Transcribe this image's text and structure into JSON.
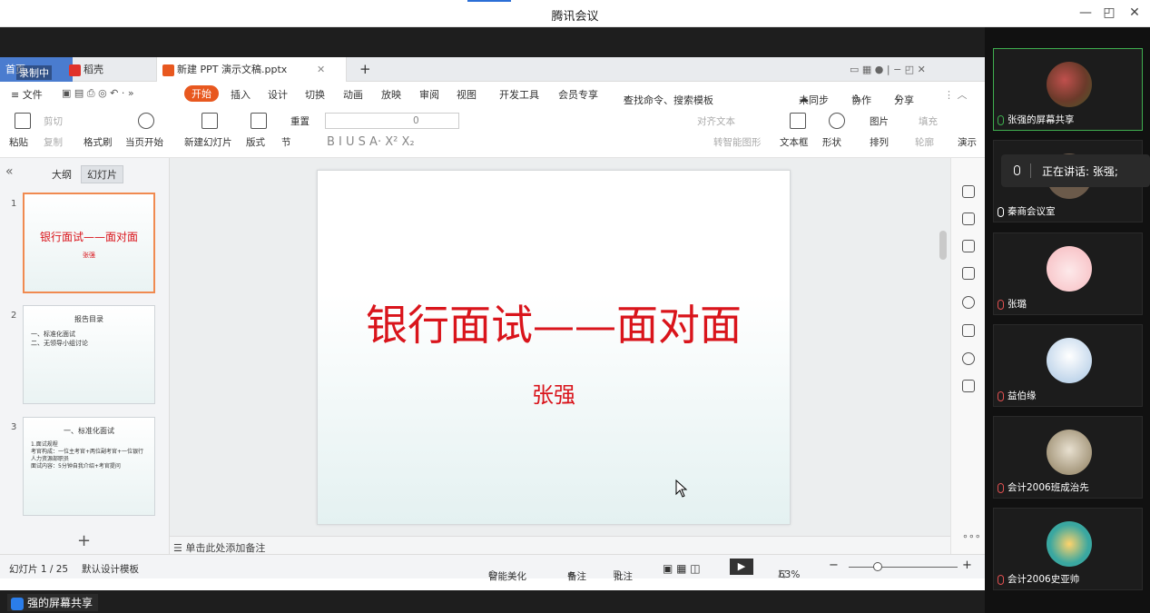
{
  "window": {
    "title": "腾讯会议",
    "minimize": "—",
    "restore": "◰",
    "close": "✕"
  },
  "tabs": {
    "home": "首页",
    "recording": "录制中",
    "daoke": "稻壳",
    "doc": "新建 PPT 演示文稿.pptx",
    "new": "+"
  },
  "menu": [
    "≡ 文件",
    "开始",
    "插入",
    "设计",
    "切换",
    "动画",
    "放映",
    "审阅",
    "视图",
    "开发工具",
    "会员专享"
  ],
  "menu_right": {
    "search": "查找命令、搜索模板",
    "sync": "未同步",
    "collab": "协作",
    "share": "分享"
  },
  "ribbon": {
    "paste": "粘贴",
    "cut": "剪切",
    "copy": "复制",
    "format_painter": "格式刷",
    "from_start": "当页开始",
    "new_slide": "新建幻灯片",
    "layout": "版式",
    "section": "节",
    "reset": "重置",
    "font_size": "0",
    "align_text": "对齐文本",
    "smartart": "转智能图形",
    "textbox": "文本框",
    "shape": "形状",
    "picture": "图片",
    "arrange": "排列",
    "fill": "填充",
    "outline": "轮廓",
    "play": "演示"
  },
  "left_panel": {
    "outline": "大纲",
    "slides": "幻灯片",
    "collapse": "«",
    "add": "+"
  },
  "thumbnails": [
    {
      "num": "1",
      "title": "银行面试——面对面",
      "sub": "张强"
    },
    {
      "num": "2",
      "title": "报告目录",
      "items": [
        "一、标准化面试",
        "二、无领导小组讨论"
      ]
    },
    {
      "num": "3",
      "title": "一、标准化面试",
      "items": [
        "1.面试规程",
        "考官构成：一位主考官+两位副考官+一位银行人力资源部职员",
        "面试内容：5分钟自我介绍+考官提问"
      ]
    }
  ],
  "slide": {
    "title": "银行面试——面对面",
    "subtitle": "张强"
  },
  "notes": "单击此处添加备注",
  "status": {
    "slide_counter": "幻灯片 1 / 25",
    "template": "默认设计模板",
    "beautify": "智能美化",
    "notes": "备注",
    "comment": "批注",
    "zoom": "63%"
  },
  "share_label": "强的屏幕共享",
  "speaking": "正在讲话: 张强;",
  "participants": [
    {
      "name": "张强的屏幕共享"
    },
    {
      "name": "秦商会议室"
    },
    {
      "name": "张璐"
    },
    {
      "name": "益伯缘"
    },
    {
      "name": "会计2006班成治先"
    },
    {
      "name": "会计2006史亚帅"
    }
  ]
}
